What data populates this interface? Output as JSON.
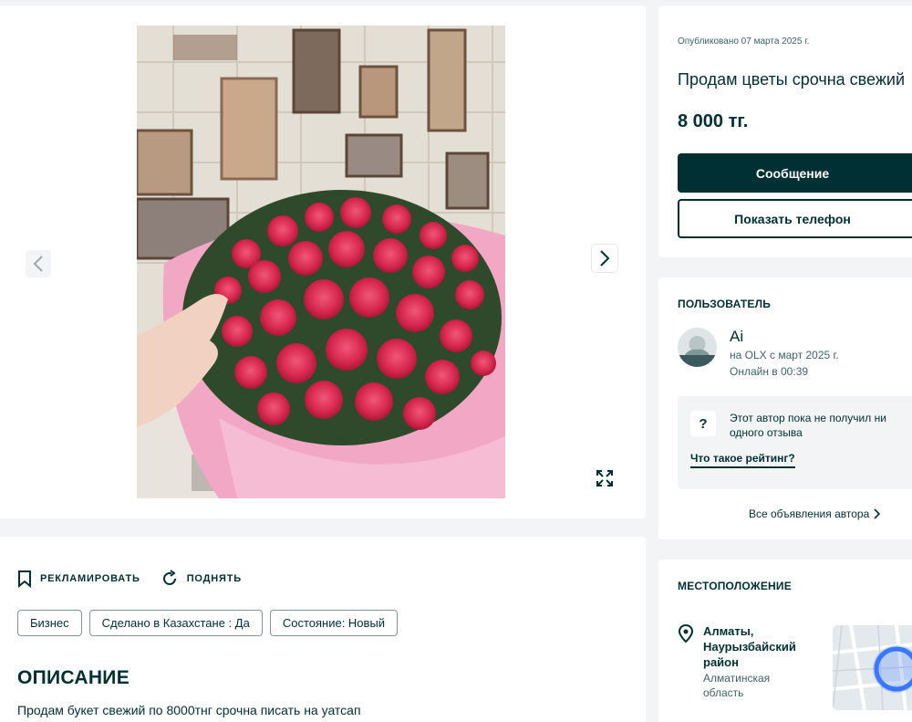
{
  "gallery": {
    "photo_alt": "Букет роз",
    "prev_icon": "chevron-left-icon",
    "next_icon": "chevron-right-icon",
    "expand_icon": "expand-icon"
  },
  "details": {
    "promote_label": "РЕКЛАМИРОВАТЬ",
    "raise_label": "ПОДНЯТЬ",
    "tags": [
      "Бизнес",
      "Сделано в Казахстане : Да",
      "Состояние: Новый"
    ],
    "description_title": "ОПИСАНИЕ",
    "description_text": "Продам букет свежий по 8000тнг срочна писать на уатсап"
  },
  "listing": {
    "published": "Опубликовано 07 марта 2025 г.",
    "title": "Продам цветы срочна свежий",
    "price": "8 000 тг.",
    "message_button": "Сообщение",
    "phone_button": "Показать телефон"
  },
  "user": {
    "section_title": "ПОЛЬЗОВАТЕЛЬ",
    "name": "Ai",
    "since": "на OLX с март 2025 г.",
    "online": "Онлайн в 00:39",
    "rating_text": "Этот автор пока не получил ни одного отзыва",
    "rating_link": "Что такое рейтинг?",
    "all_ads": "Все объявления автора"
  },
  "location": {
    "section_title": "МЕСТОПОЛОЖЕНИЕ",
    "city": "Алматы, Наурызбайский район",
    "region": "Алматинская область"
  },
  "colors": {
    "primary": "#002f34",
    "background": "#f2f4f5",
    "muted_text": "#406367",
    "map_marker": "#3a77ff"
  }
}
